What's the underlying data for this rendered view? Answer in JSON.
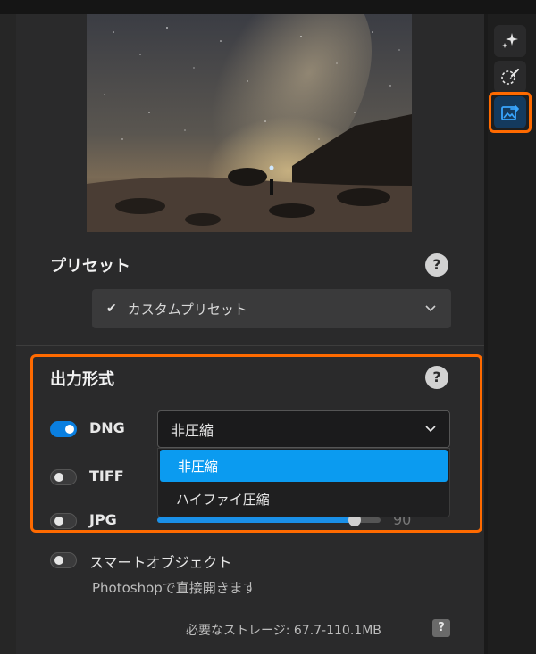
{
  "preset": {
    "title": "プリセット",
    "help": "?",
    "selected": "カスタムプリセット",
    "check_icon": "check-icon",
    "chevron_icon": "chevron-down-icon"
  },
  "output_format": {
    "title": "出力形式",
    "help": "?",
    "dng": {
      "label": "DNG",
      "enabled": true,
      "compression": "非圧縮"
    },
    "dropdown_options": [
      "非圧縮",
      "ハイファイ圧縮"
    ],
    "tiff": {
      "label": "TIFF",
      "enabled": false
    },
    "jpg": {
      "label": "JPG",
      "enabled": false,
      "quality": "90",
      "quality_level": 0.9
    }
  },
  "smart_object": {
    "label": "スマートオブジェクト",
    "enabled": false,
    "description": "Photoshopで直接開きます"
  },
  "storage": {
    "text": "必要なストレージ: 67.7-110.1MB",
    "help": "?"
  },
  "toolbar": {
    "tools": [
      "sparkle-icon",
      "brush-select-icon",
      "export-image-icon"
    ],
    "active_tool": "export-image-icon"
  },
  "colors": {
    "accent": "#0b9bf0",
    "highlight": "#ff6a00",
    "panel": "#2a2a2b"
  }
}
